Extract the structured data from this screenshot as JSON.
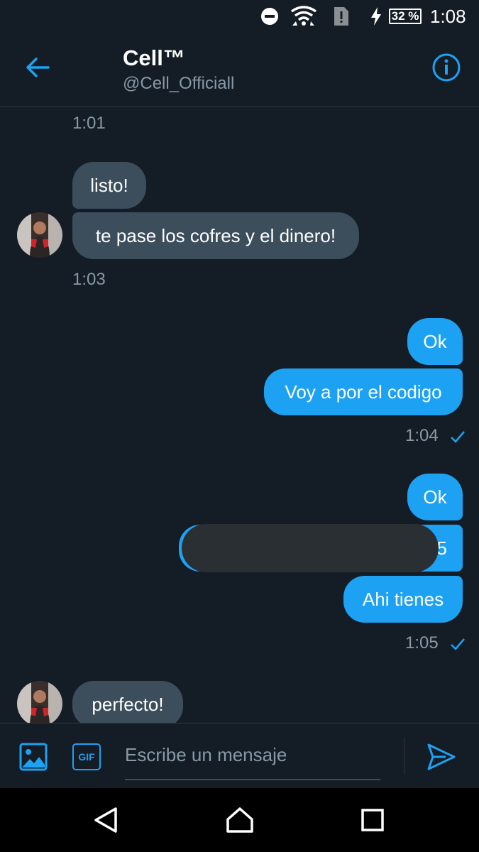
{
  "status_bar": {
    "time": "1:08",
    "battery": "32 %",
    "icons": [
      "do-not-disturb-icon",
      "wifi-icon",
      "sim-alert-icon",
      "charging-bolt-icon",
      "battery-icon"
    ]
  },
  "header": {
    "title": "Cell™",
    "handle": "@Cell_Officiall",
    "back_icon": "arrow-left-icon",
    "info_icon": "info-icon"
  },
  "messages": {
    "ts_101": "1:01",
    "msg_listo": "listo!",
    "msg_cofres": "te pase los cofres y el dinero!",
    "ts_103": "1:03",
    "msg_ok1": "Ok",
    "msg_codigo": "Voy a por el codigo",
    "ts_104": "1:04",
    "msg_ok2": "Ok",
    "msg_redacted_tail": "5",
    "msg_ahi": "Ahi tienes",
    "ts_105": "1:05",
    "msg_perfecto": "perfecto!"
  },
  "composer": {
    "placeholder": "Escribe un mensaje",
    "gif_label": "GIF",
    "media_icon": "image-icon",
    "send_icon": "send-icon"
  },
  "colors": {
    "background": "#141d26",
    "incoming_bubble": "#3c4d5c",
    "outgoing_bubble": "#1da1f2",
    "accent": "#1da1f2",
    "muted_text": "#8899a6"
  }
}
